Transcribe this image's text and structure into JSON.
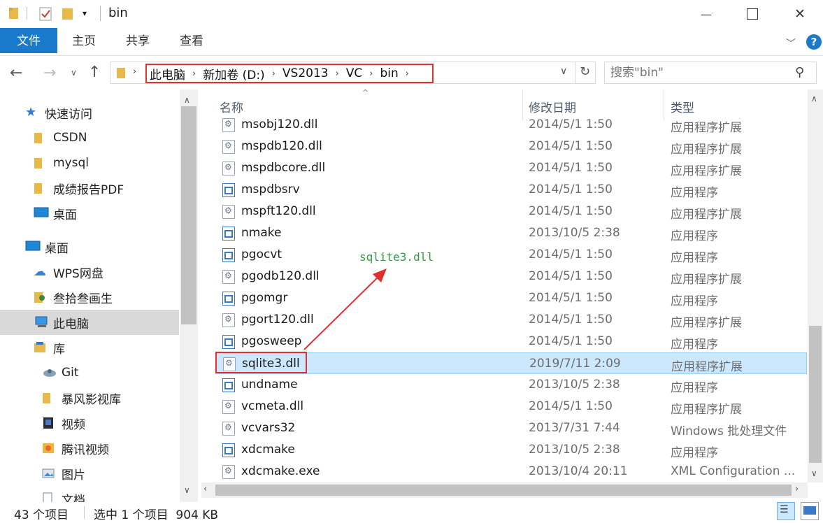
{
  "window": {
    "title": "bin",
    "minimize_symbol": "—",
    "maximize_symbol": "☐",
    "close_symbol": "✕"
  },
  "ribbon": {
    "tabs": [
      "文件",
      "主页",
      "共享",
      "查看"
    ],
    "help_symbol": "?"
  },
  "address": {
    "crumbs": [
      "此电脑",
      "新加卷 (D:)",
      "VS2013",
      "VC",
      "bin"
    ],
    "search_placeholder": "搜索\"bin\""
  },
  "sidebar": {
    "items": [
      {
        "label": "快速访问",
        "icon": "star-icon"
      },
      {
        "label": "CSDN",
        "icon": "folder-icon"
      },
      {
        "label": "mysql",
        "icon": "folder-icon"
      },
      {
        "label": "成绩报告PDF",
        "icon": "folder-icon"
      },
      {
        "label": "桌面",
        "icon": "desktop-icon"
      },
      {
        "label": "桌面",
        "icon": "desktop-icon"
      },
      {
        "label": "WPS网盘",
        "icon": "cloud-icon"
      },
      {
        "label": "叁拾叁画生",
        "icon": "user-folder-icon"
      },
      {
        "label": "此电脑",
        "icon": "computer-icon"
      },
      {
        "label": "库",
        "icon": "library-icon"
      },
      {
        "label": "Git",
        "icon": "git-icon"
      },
      {
        "label": "暴风影视库",
        "icon": "folder-icon"
      },
      {
        "label": "视频",
        "icon": "video-icon"
      },
      {
        "label": "腾讯视频",
        "icon": "tencent-video-icon"
      },
      {
        "label": "图片",
        "icon": "picture-icon"
      },
      {
        "label": "文档",
        "icon": "document-icon"
      }
    ]
  },
  "columns": {
    "name": "名称",
    "date": "修改日期",
    "type": "类型"
  },
  "files": [
    {
      "name": "msobj120.dll",
      "date": "2014/5/1 1:50",
      "type": "应用程序扩展",
      "kind": "dll"
    },
    {
      "name": "mspdb120.dll",
      "date": "2014/5/1 1:50",
      "type": "应用程序扩展",
      "kind": "dll"
    },
    {
      "name": "mspdbcore.dll",
      "date": "2014/5/1 1:50",
      "type": "应用程序扩展",
      "kind": "dll"
    },
    {
      "name": "mspdbsrv",
      "date": "2014/5/1 1:50",
      "type": "应用程序",
      "kind": "exe"
    },
    {
      "name": "mspft120.dll",
      "date": "2014/5/1 1:50",
      "type": "应用程序扩展",
      "kind": "dll"
    },
    {
      "name": "nmake",
      "date": "2013/10/5 2:38",
      "type": "应用程序",
      "kind": "exe"
    },
    {
      "name": "pgocvt",
      "date": "2014/5/1 1:50",
      "type": "应用程序",
      "kind": "exe"
    },
    {
      "name": "pgodb120.dll",
      "date": "2014/5/1 1:50",
      "type": "应用程序扩展",
      "kind": "dll"
    },
    {
      "name": "pgomgr",
      "date": "2014/5/1 1:50",
      "type": "应用程序",
      "kind": "exe"
    },
    {
      "name": "pgort120.dll",
      "date": "2014/5/1 1:50",
      "type": "应用程序扩展",
      "kind": "dll"
    },
    {
      "name": "pgosweep",
      "date": "2014/5/1 1:50",
      "type": "应用程序",
      "kind": "exe"
    },
    {
      "name": "sqlite3.dll",
      "date": "2019/7/11 2:09",
      "type": "应用程序扩展",
      "kind": "dll",
      "selected": true
    },
    {
      "name": "undname",
      "date": "2013/10/5 2:38",
      "type": "应用程序",
      "kind": "exe"
    },
    {
      "name": "vcmeta.dll",
      "date": "2014/5/1 1:50",
      "type": "应用程序扩展",
      "kind": "dll"
    },
    {
      "name": "vcvars32",
      "date": "2013/7/31 7:44",
      "type": "Windows 批处理文件",
      "kind": "bat"
    },
    {
      "name": "xdcmake",
      "date": "2013/10/5 2:38",
      "type": "应用程序",
      "kind": "exe"
    },
    {
      "name": "xdcmake.exe",
      "date": "2013/10/4 20:11",
      "type": "XML Configuration ...",
      "kind": "config"
    }
  ],
  "annotation": "sqlite3.dll",
  "status": {
    "count": "43 个项目",
    "selection": "选中 1 个项目  904 KB"
  },
  "colors": {
    "accent": "#1979ca",
    "highlight": "#e0302f",
    "annotation": "#2f9b45",
    "selection_bg": "#cce8ff"
  }
}
